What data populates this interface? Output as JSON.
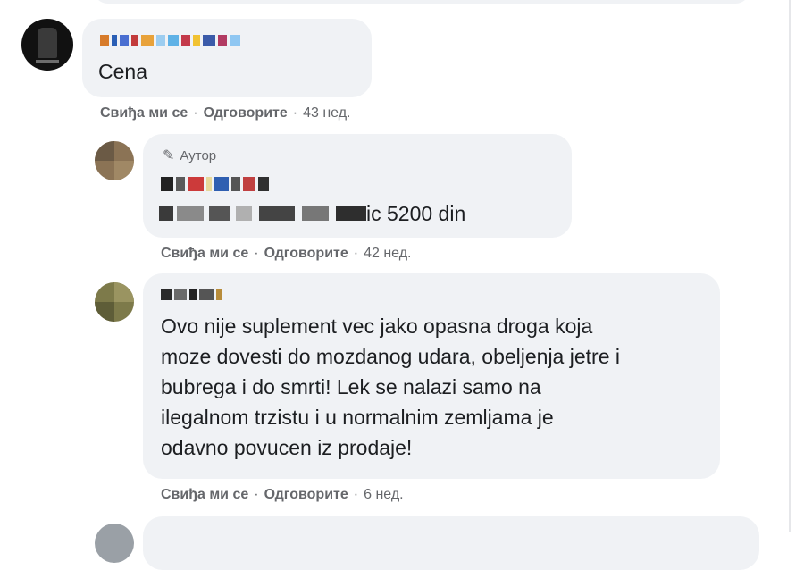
{
  "comments": [
    {
      "text": "Cena",
      "actions": {
        "like": "Свиђа ми се",
        "reply": "Одговорите",
        "time": "43 нед."
      }
    },
    {
      "badge": "Аутор",
      "text_tail": "ic 5200 din",
      "actions": {
        "like": "Свиђа ми се",
        "reply": "Одговорите",
        "time": "42 нед."
      }
    },
    {
      "text_lines": [
        "Ovo nije suplement vec jako opasna droga koja",
        "moze dovesti do mozdanog udara, obeljenja jetre i",
        "bubrega i do smrti! Lek se nalazi samo na",
        "ilegalnom trzistu i u normalnim zemljama je",
        "odavno povucen iz prodaje!"
      ],
      "actions": {
        "like": "Свиђа ми се",
        "reply": "Одговорите",
        "time": "6 нед."
      }
    }
  ],
  "separator": "·",
  "icons": {
    "badge_icon": "pencil-icon"
  }
}
